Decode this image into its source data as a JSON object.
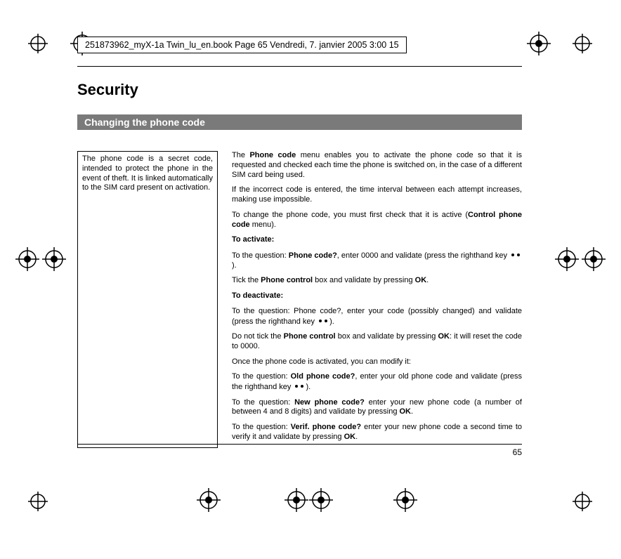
{
  "banner": "251873962_myX-1a Twin_lu_en.book  Page 65  Vendredi, 7. janvier 2005  3:00 15",
  "title": "Security",
  "sectionHeading": "Changing the phone code",
  "sidebarNote": "The phone code is a secret code, intended to protect the phone in the event of theft. It is linked automatically to the SIM card present on activation.",
  "p1a": "The ",
  "p1b": "Phone code",
  "p1c": " menu enables you to activate the phone code so that it is requested and checked each time the phone is switched on, in the case of a different SIM card being used.",
  "p2": "If the incorrect code is entered, the time interval between each attempt increases, making use impossible.",
  "p3a": "To change the phone code, you must first check that it is active (",
  "p3b": "Control phone code",
  "p3c": " menu).",
  "activateHeading": "To activate:",
  "p4a": "To the question: ",
  "p4b": "Phone code?",
  "p4c": ", enter 0000 and validate (press the righthand key ",
  "p4d": ").",
  "p5a": "Tick the ",
  "p5b": "Phone control",
  "p5c": " box and validate by pressing ",
  "p5d": "OK",
  "p5e": ".",
  "deactivateHeading": "To deactivate:",
  "p6a": "To the question: Phone code?, enter your code (possibly changed) and validate (press the righthand key ",
  "p6b": ").",
  "p7a": "Do not tick the ",
  "p7b": "Phone control",
  "p7c": " box and validate by pressing ",
  "p7d": "OK",
  "p7e": ": it will reset the code to 0000.",
  "p8": "Once the phone code is activated, you can modify it:",
  "p9a": "To the question: ",
  "p9b": "Old phone code?",
  "p9c": ", enter your old phone code and validate (press the righthand key ",
  "p9d": ").",
  "p10a": "To the question: ",
  "p10b": "New phone code?",
  "p10c": " enter your new phone code (a number of between 4 and 8 digits) and validate by pressing ",
  "p10d": "OK",
  "p10e": ".",
  "p11a": "To the question: ",
  "p11b": "Verif. phone code?",
  "p11c": " enter your new phone code a second time to verify it and validate by pressing ",
  "p11d": "OK",
  "p11e": ".",
  "pageNumber": "65"
}
